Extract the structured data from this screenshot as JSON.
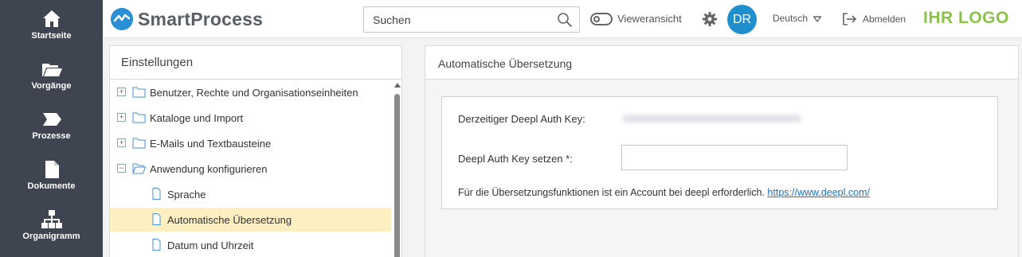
{
  "nav": {
    "items": [
      {
        "label": "Startseite",
        "icon": "home-icon"
      },
      {
        "label": "Vorgänge",
        "icon": "folder-open-icon"
      },
      {
        "label": "Prozesse",
        "icon": "process-arrow-icon"
      },
      {
        "label": "Dokumente",
        "icon": "document-icon"
      },
      {
        "label": "Organigramm",
        "icon": "org-chart-icon"
      }
    ]
  },
  "header": {
    "brand": "SmartProcess",
    "search_placeholder": "Suchen",
    "viewer_label": "Vieweransicht",
    "avatar_initials": "DR",
    "language": "Deutsch",
    "logout_label": "Abmelden",
    "customer_logo": "IHR LOGO"
  },
  "settings": {
    "title": "Einstellungen",
    "tree": [
      {
        "label": "Benutzer, Rechte und Organisationseinheiten",
        "type": "folder",
        "expander": "+",
        "selected": false
      },
      {
        "label": "Kataloge und Import",
        "type": "folder",
        "expander": "+",
        "selected": false
      },
      {
        "label": "E-Mails und Textbausteine",
        "type": "folder",
        "expander": "+",
        "selected": false
      },
      {
        "label": "Anwendung konfigurieren",
        "type": "folder-open",
        "expander": "−",
        "selected": false
      },
      {
        "label": "Sprache",
        "type": "page",
        "expander": "",
        "selected": false
      },
      {
        "label": "Automatische Übersetzung",
        "type": "page",
        "expander": "",
        "selected": true
      },
      {
        "label": "Datum und Uhrzeit",
        "type": "page",
        "expander": "",
        "selected": false
      }
    ]
  },
  "content": {
    "title": "Automatische Übersetzung",
    "current_key_label": "Derzeitiger Deepl Auth Key:",
    "set_key_label": "Deepl Auth Key setzen *:",
    "set_key_value": "",
    "info_text": "Für die Übersetzungsfunktionen ist ein Account bei deepl erforderlich. ",
    "info_link": "https://www.deepl.com/"
  },
  "colors": {
    "nav_bg": "#3f4550",
    "accent": "#1f8fce",
    "selected_row": "#fdefbf",
    "customer_logo": "#8bc34a"
  }
}
